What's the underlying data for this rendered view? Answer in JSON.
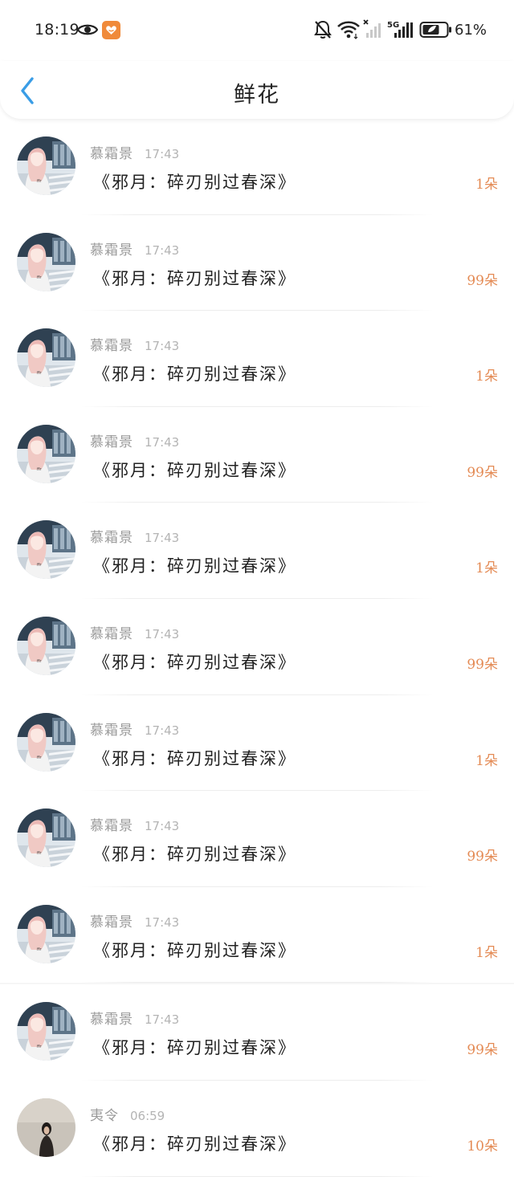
{
  "status_bar": {
    "time": "18:19",
    "network": "5G",
    "battery": "61%",
    "icons": [
      "eye-icon",
      "app-notification-icon",
      "bell-muted-icon",
      "wifi-icon",
      "signal-sim1-icon",
      "signal-sim2-icon",
      "battery-icon"
    ]
  },
  "header": {
    "title": "鲜花",
    "back_icon": "chevron-left-icon"
  },
  "colors": {
    "accent_blue": "#3a9de6",
    "count_orange": "#e48b55",
    "secondary_text": "#9a9a9a"
  },
  "items": [
    {
      "name": "慕霜景",
      "time": "17:43",
      "book": "《邪月：碎刃别过春深》",
      "count": "1朵",
      "avatar": "avatar-girl"
    },
    {
      "name": "慕霜景",
      "time": "17:43",
      "book": "《邪月：碎刃别过春深》",
      "count": "99朵",
      "avatar": "avatar-girl"
    },
    {
      "name": "慕霜景",
      "time": "17:43",
      "book": "《邪月：碎刃别过春深》",
      "count": "1朵",
      "avatar": "avatar-girl"
    },
    {
      "name": "慕霜景",
      "time": "17:43",
      "book": "《邪月：碎刃别过春深》",
      "count": "99朵",
      "avatar": "avatar-girl"
    },
    {
      "name": "慕霜景",
      "time": "17:43",
      "book": "《邪月：碎刃别过春深》",
      "count": "1朵",
      "avatar": "avatar-girl"
    },
    {
      "name": "慕霜景",
      "time": "17:43",
      "book": "《邪月：碎刃别过春深》",
      "count": "99朵",
      "avatar": "avatar-girl"
    },
    {
      "name": "慕霜景",
      "time": "17:43",
      "book": "《邪月：碎刃别过春深》",
      "count": "1朵",
      "avatar": "avatar-girl"
    },
    {
      "name": "慕霜景",
      "time": "17:43",
      "book": "《邪月：碎刃别过春深》",
      "count": "99朵",
      "avatar": "avatar-girl"
    },
    {
      "name": "慕霜景",
      "time": "17:43",
      "book": "《邪月：碎刃别过春深》",
      "count": "1朵",
      "avatar": "avatar-girl"
    },
    {
      "name": "慕霜景",
      "time": "17:43",
      "book": "《邪月：碎刃别过春深》",
      "count": "99朵",
      "avatar": "avatar-girl"
    },
    {
      "name": "夷令",
      "time": "06:59",
      "book": "《邪月：碎刃别过春深》",
      "count": "10朵",
      "avatar": "avatar-dark"
    }
  ]
}
